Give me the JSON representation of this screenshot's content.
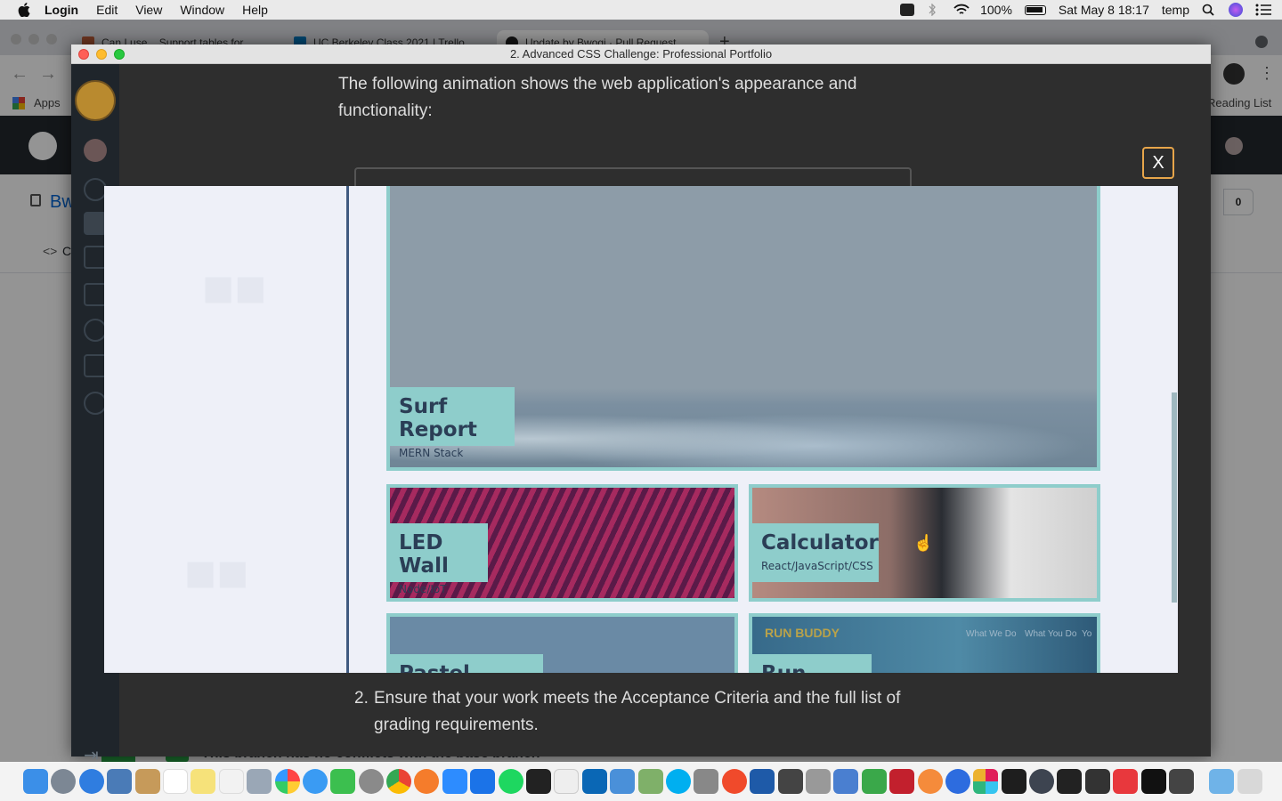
{
  "menubar": {
    "app_name": "Login",
    "items": [
      "Edit",
      "View",
      "Window",
      "Help"
    ],
    "battery": "100%",
    "clock": "Sat May 8  18:17",
    "user": "temp"
  },
  "browser": {
    "tabs": [
      {
        "label": "Can I use... Support tables for..."
      },
      {
        "label": "UC Berkeley Class 2021 | Trello"
      },
      {
        "label": "Update by Bwogi · Pull Request..."
      }
    ],
    "bookmarks_apps": "Apps",
    "reading_list": "Reading List"
  },
  "github": {
    "repo_prefix": "Bw",
    "code_tab": "C",
    "counter": "0",
    "branch_status": "This branch has no conflicts with the base branch"
  },
  "appwindow": {
    "title": "2. Advanced CSS Challenge: Professional Portfolio",
    "intro": "The following animation shows the web application's appearance and functionality:",
    "step_number": "2.",
    "step_text": "Ensure that your work meets the Acceptance Criteria and the full list of grading requirements."
  },
  "modal": {
    "close_label": "X",
    "projects": [
      {
        "title": "Surf Report",
        "subtitle": "MERN Stack"
      },
      {
        "title": "LED Wall",
        "subtitle": "Node/IoT"
      },
      {
        "title": "Calculator",
        "subtitle": "React/JavaScript/CSS"
      },
      {
        "title": "Pastel Puzzels",
        "subtitle": ""
      },
      {
        "title": "Run Buddy",
        "subtitle": ""
      }
    ],
    "run_buddy_logo": "RUN BUDDY",
    "run_buddy_nav": [
      "What We Do",
      "What You Do",
      "Yo"
    ]
  },
  "colors": {
    "card_accent": "#8ecdcb",
    "card_text": "#2b3e56",
    "close_border": "#e7a54a"
  }
}
